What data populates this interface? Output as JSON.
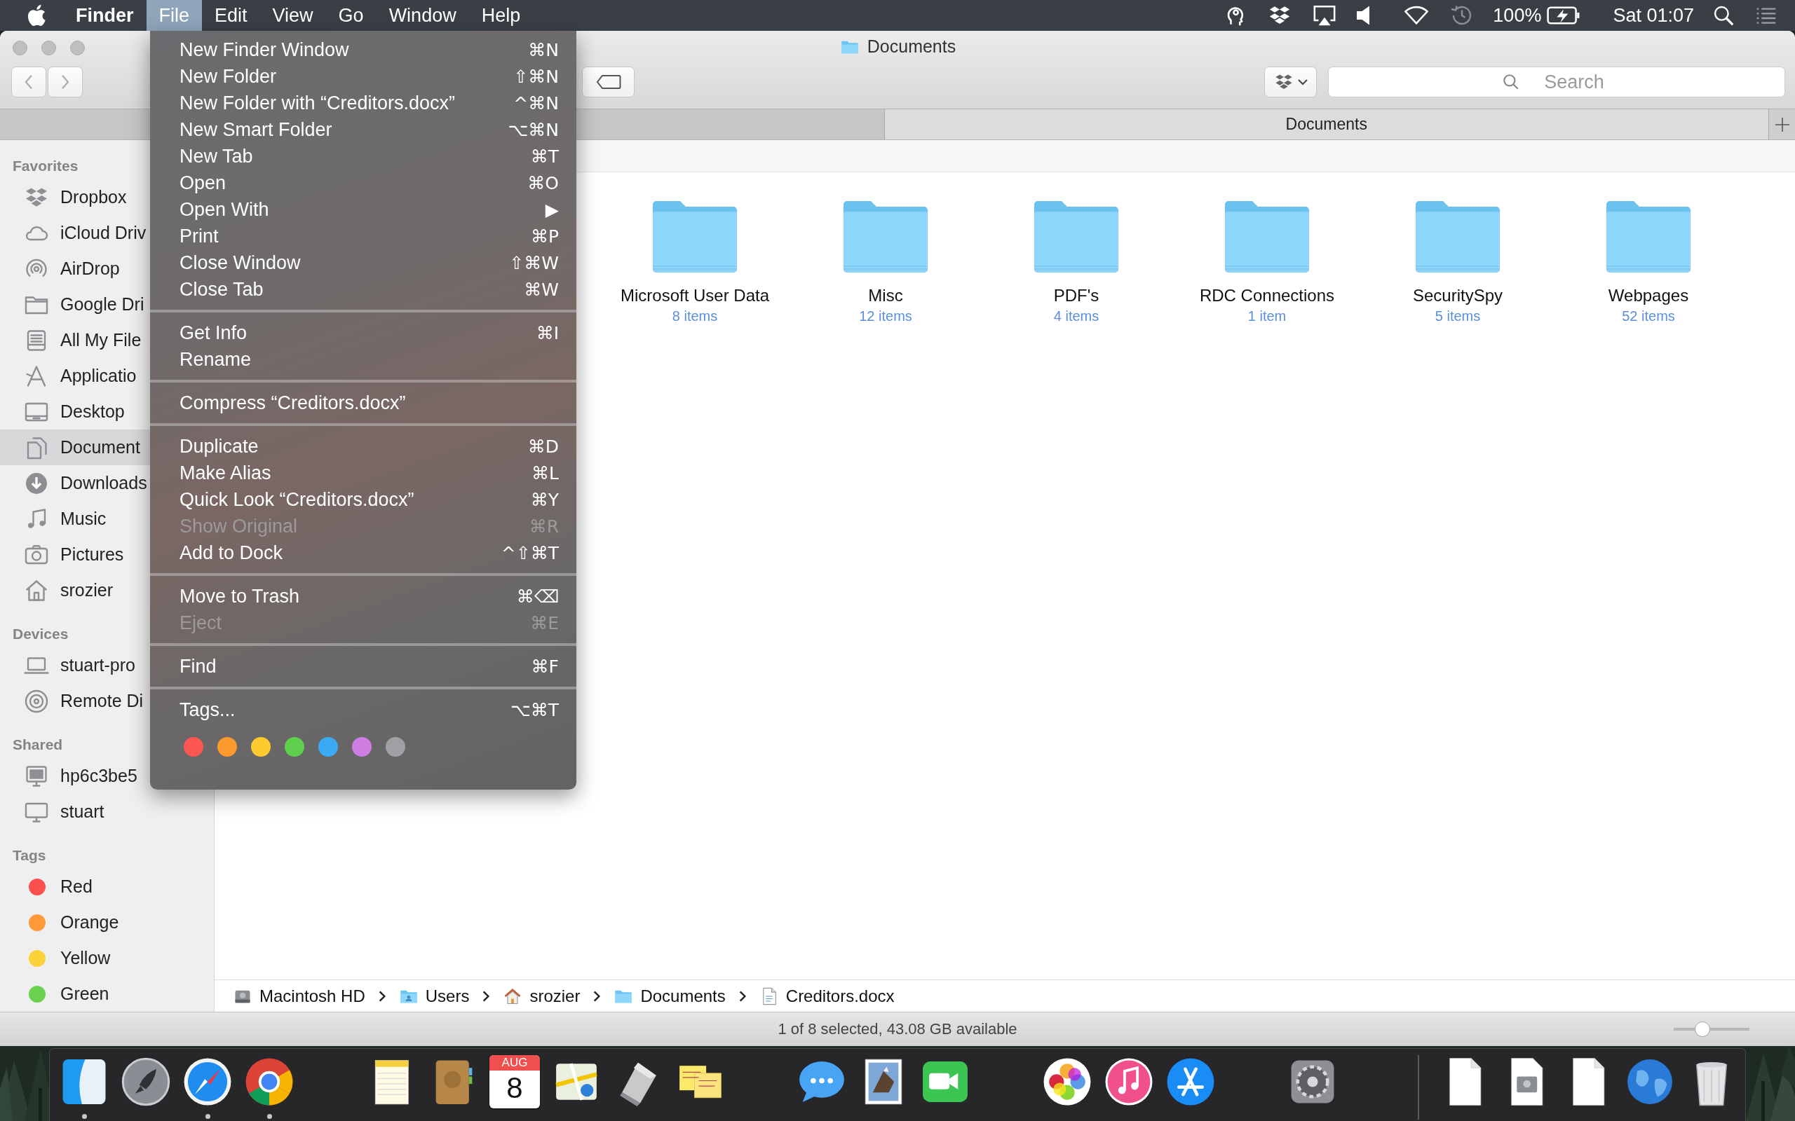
{
  "menubar": {
    "items": [
      {
        "label": "Finder",
        "kind": "app",
        "selected": false
      },
      {
        "label": "File",
        "kind": "menu",
        "selected": true
      },
      {
        "label": "Edit",
        "kind": "menu",
        "selected": false
      },
      {
        "label": "View",
        "kind": "menu",
        "selected": false
      },
      {
        "label": "Go",
        "kind": "menu",
        "selected": false
      },
      {
        "label": "Window",
        "kind": "menu",
        "selected": false
      },
      {
        "label": "Help",
        "kind": "menu",
        "selected": false
      }
    ],
    "battery": "100%",
    "clock": "Sat 01:07"
  },
  "file_menu": {
    "entries": [
      {
        "kind": "item",
        "label": "New Finder Window",
        "shortcut": "⌘N",
        "disabled": false
      },
      {
        "kind": "item",
        "label": "New Folder",
        "shortcut": "⇧⌘N",
        "disabled": false
      },
      {
        "kind": "item",
        "label": "New Folder with “Creditors.docx”",
        "shortcut": "^⌘N",
        "disabled": false
      },
      {
        "kind": "item",
        "label": "New Smart Folder",
        "shortcut": "⌥⌘N",
        "disabled": false
      },
      {
        "kind": "item",
        "label": "New Tab",
        "shortcut": "⌘T",
        "disabled": false
      },
      {
        "kind": "item",
        "label": "Open",
        "shortcut": "⌘O",
        "disabled": false
      },
      {
        "kind": "item",
        "label": "Open With",
        "shortcut": "▶",
        "disabled": false
      },
      {
        "kind": "item",
        "label": "Print",
        "shortcut": "⌘P",
        "disabled": false
      },
      {
        "kind": "item",
        "label": "Close Window",
        "shortcut": "⇧⌘W",
        "disabled": false
      },
      {
        "kind": "item",
        "label": "Close Tab",
        "shortcut": "⌘W",
        "disabled": false
      },
      {
        "kind": "separator"
      },
      {
        "kind": "item",
        "label": "Get Info",
        "shortcut": "⌘I",
        "disabled": false
      },
      {
        "kind": "item",
        "label": "Rename",
        "disabled": false
      },
      {
        "kind": "separator"
      },
      {
        "kind": "item",
        "label": "Compress “Creditors.docx”",
        "disabled": false
      },
      {
        "kind": "separator"
      },
      {
        "kind": "item",
        "label": "Duplicate",
        "shortcut": "⌘D",
        "disabled": false
      },
      {
        "kind": "item",
        "label": "Make Alias",
        "shortcut": "⌘L",
        "disabled": false
      },
      {
        "kind": "item",
        "label": "Quick Look “Creditors.docx”",
        "shortcut": "⌘Y",
        "disabled": false
      },
      {
        "kind": "item",
        "label": "Show Original",
        "shortcut": "⌘R",
        "disabled": true
      },
      {
        "kind": "item",
        "label": "Add to Dock",
        "shortcut": "^⇧⌘T",
        "disabled": false
      },
      {
        "kind": "separator"
      },
      {
        "kind": "item",
        "label": "Move to Trash",
        "shortcut": "⌘⌫",
        "disabled": false
      },
      {
        "kind": "item",
        "label": "Eject",
        "shortcut": "⌘E",
        "disabled": true
      },
      {
        "kind": "separator"
      },
      {
        "kind": "item",
        "label": "Find",
        "shortcut": "⌘F",
        "disabled": false
      },
      {
        "kind": "separator"
      },
      {
        "kind": "item",
        "label": "Tags...",
        "shortcut": "⌥⌘T",
        "disabled": false
      },
      {
        "kind": "tags",
        "colors": [
          {
            "color": "#fc5753"
          },
          {
            "color": "#fd9a2e"
          },
          {
            "color": "#fecb2f"
          },
          {
            "color": "#5fcf4d"
          },
          {
            "color": "#3baaf5"
          },
          {
            "color": "#cd7ee0"
          },
          {
            "color": "#a0a0a4"
          }
        ]
      }
    ]
  },
  "window": {
    "title": "Documents",
    "tabs": [
      {
        "selected": false
      },
      {
        "label": "Documents",
        "selected": true
      }
    ],
    "search": {
      "placeholder": "Search"
    }
  },
  "sidebar": {
    "sections": [
      {
        "heading": "Favorites",
        "items": [
          {
            "label": "Dropbox",
            "kind": "dropbox",
            "selected": false
          },
          {
            "label": "iCloud Driv",
            "kind": "cloud",
            "selected": false
          },
          {
            "label": "AirDrop",
            "kind": "airdrop",
            "selected": false
          },
          {
            "label": "Google Dri",
            "kind": "folder",
            "selected": false
          },
          {
            "label": "All My File",
            "kind": "allfiles",
            "selected": false
          },
          {
            "label": "Applicatio",
            "kind": "apps",
            "selected": false
          },
          {
            "label": "Desktop",
            "kind": "desktop",
            "selected": false
          },
          {
            "label": "Document",
            "kind": "documents",
            "selected": true
          },
          {
            "label": "Downloads",
            "kind": "downloads",
            "selected": false
          },
          {
            "label": "Music",
            "kind": "music",
            "selected": false
          },
          {
            "label": "Pictures",
            "kind": "pictures",
            "selected": false
          },
          {
            "label": "srozier",
            "kind": "home",
            "selected": false
          }
        ]
      },
      {
        "heading": "Devices",
        "items": [
          {
            "label": "stuart-pro",
            "kind": "laptop",
            "selected": false
          },
          {
            "label": "Remote Di",
            "kind": "disc",
            "selected": false
          }
        ]
      },
      {
        "heading": "Shared",
        "items": [
          {
            "label": "hp6c3be5",
            "kind": "monitor",
            "selected": false
          },
          {
            "label": "stuart",
            "kind": "imac",
            "selected": false
          }
        ]
      },
      {
        "heading": "Tags",
        "items": [
          {
            "label": "Red",
            "kind": "tag",
            "color": "#fc4f4f",
            "selected": false
          },
          {
            "label": "Orange",
            "kind": "tag",
            "color": "#fd9a37",
            "selected": false
          },
          {
            "label": "Yellow",
            "kind": "tag",
            "color": "#fdd13a",
            "selected": false
          },
          {
            "label": "Green",
            "kind": "tag",
            "color": "#6ad04f",
            "selected": false
          }
        ]
      }
    ]
  },
  "folders": [
    {
      "name": "Microsoft User Data",
      "count": "8 items"
    },
    {
      "name": "Misc",
      "count": "12 items"
    },
    {
      "name": "PDF's",
      "count": "4 items"
    },
    {
      "name": "RDC Connections",
      "count": "1 item"
    },
    {
      "name": "SecuritySpy",
      "count": "5 items"
    },
    {
      "name": "Webpages",
      "count": "52 items"
    }
  ],
  "path_bar": [
    {
      "label": "Macintosh HD",
      "kind": "disk"
    },
    {
      "label": "Users",
      "kind": "usersfolder"
    },
    {
      "label": "srozier",
      "kind": "home"
    },
    {
      "label": "Documents",
      "kind": "folder"
    },
    {
      "label": "Creditors.docx",
      "kind": "document"
    }
  ],
  "status_bar": {
    "text": "1 of 8 selected, 43.08 GB available",
    "zoom": {
      "level": 0.38
    }
  },
  "dock": {
    "apps": [
      {
        "kind": "finder",
        "running": true
      },
      {
        "kind": "launchpad",
        "running": false
      },
      {
        "kind": "safari",
        "running": true
      },
      {
        "kind": "chrome",
        "running": true
      },
      {
        "kind": "notes",
        "running": false
      },
      {
        "kind": "contacts",
        "running": false
      },
      {
        "kind": "calendar",
        "running": false,
        "month": "AUG",
        "day": "8"
      },
      {
        "kind": "maps",
        "running": false
      },
      {
        "kind": "scroll",
        "running": false
      },
      {
        "kind": "stickies",
        "running": false
      },
      {
        "kind": "messages",
        "running": false
      },
      {
        "kind": "stamp",
        "running": false
      },
      {
        "kind": "facetime",
        "running": false
      },
      {
        "kind": "photos",
        "running": false
      },
      {
        "kind": "itunes",
        "running": false
      },
      {
        "kind": "appstore",
        "running": false
      },
      {
        "kind": "sysprefs",
        "running": false
      }
    ],
    "others": [
      {
        "kind": "document"
      },
      {
        "kind": "drivedoc"
      },
      {
        "kind": "document"
      },
      {
        "kind": "globe"
      },
      {
        "kind": "trash"
      }
    ]
  }
}
